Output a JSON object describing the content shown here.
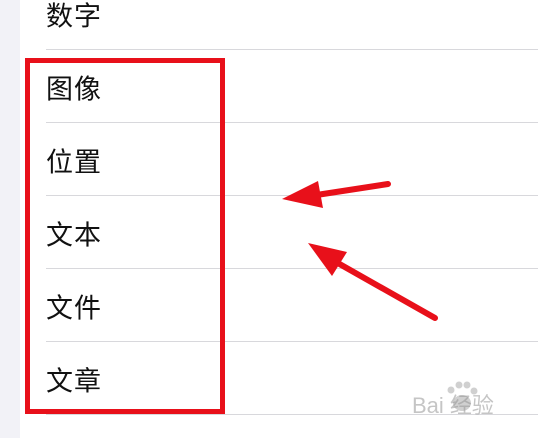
{
  "settings_list": {
    "items": [
      {
        "label": "数字"
      },
      {
        "label": "图像"
      },
      {
        "label": "位置"
      },
      {
        "label": "文本"
      },
      {
        "label": "文件"
      },
      {
        "label": "文章"
      }
    ]
  },
  "annotation": {
    "box_color": "#e8101a",
    "arrow_color": "#e8101a"
  },
  "watermark": {
    "text": "Bai 经验"
  }
}
